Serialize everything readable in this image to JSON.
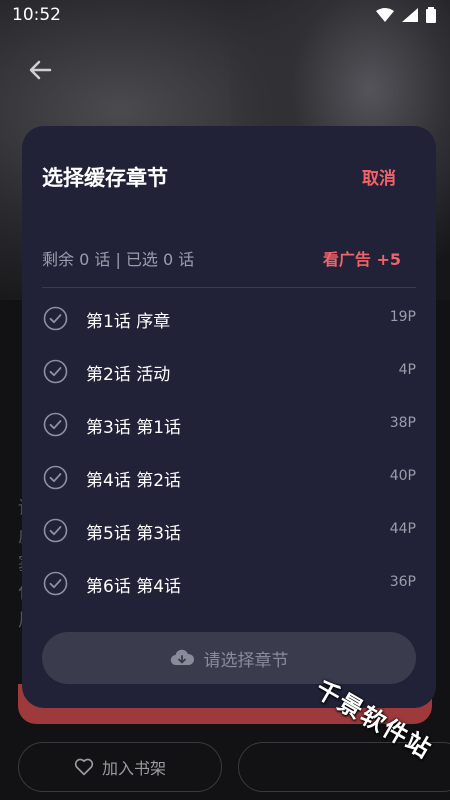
{
  "status_bar": {
    "time": "10:52"
  },
  "sheet": {
    "title": "选择缓存章节",
    "cancel_label": "取消",
    "count_text": "剩余 0 话 | 已选 0 话",
    "ad_label": "看广告 +5",
    "chapters": [
      {
        "title": "第1话 序章",
        "pages": "19P"
      },
      {
        "title": "第2话 活动",
        "pages": "4P"
      },
      {
        "title": "第3话 第1话",
        "pages": "38P"
      },
      {
        "title": "第4话 第2话",
        "pages": "40P"
      },
      {
        "title": "第5话 第3话",
        "pages": "44P"
      },
      {
        "title": "第6话 第4话",
        "pages": "36P"
      }
    ],
    "download_label": "请选择章节"
  },
  "bottom": {
    "bookshelf_label": "加入书架"
  },
  "watermark": "千景软件站",
  "colors": {
    "accent": "#f2626a",
    "sheet_bg": "#212237",
    "button_disabled": "#3a3b4d"
  }
}
